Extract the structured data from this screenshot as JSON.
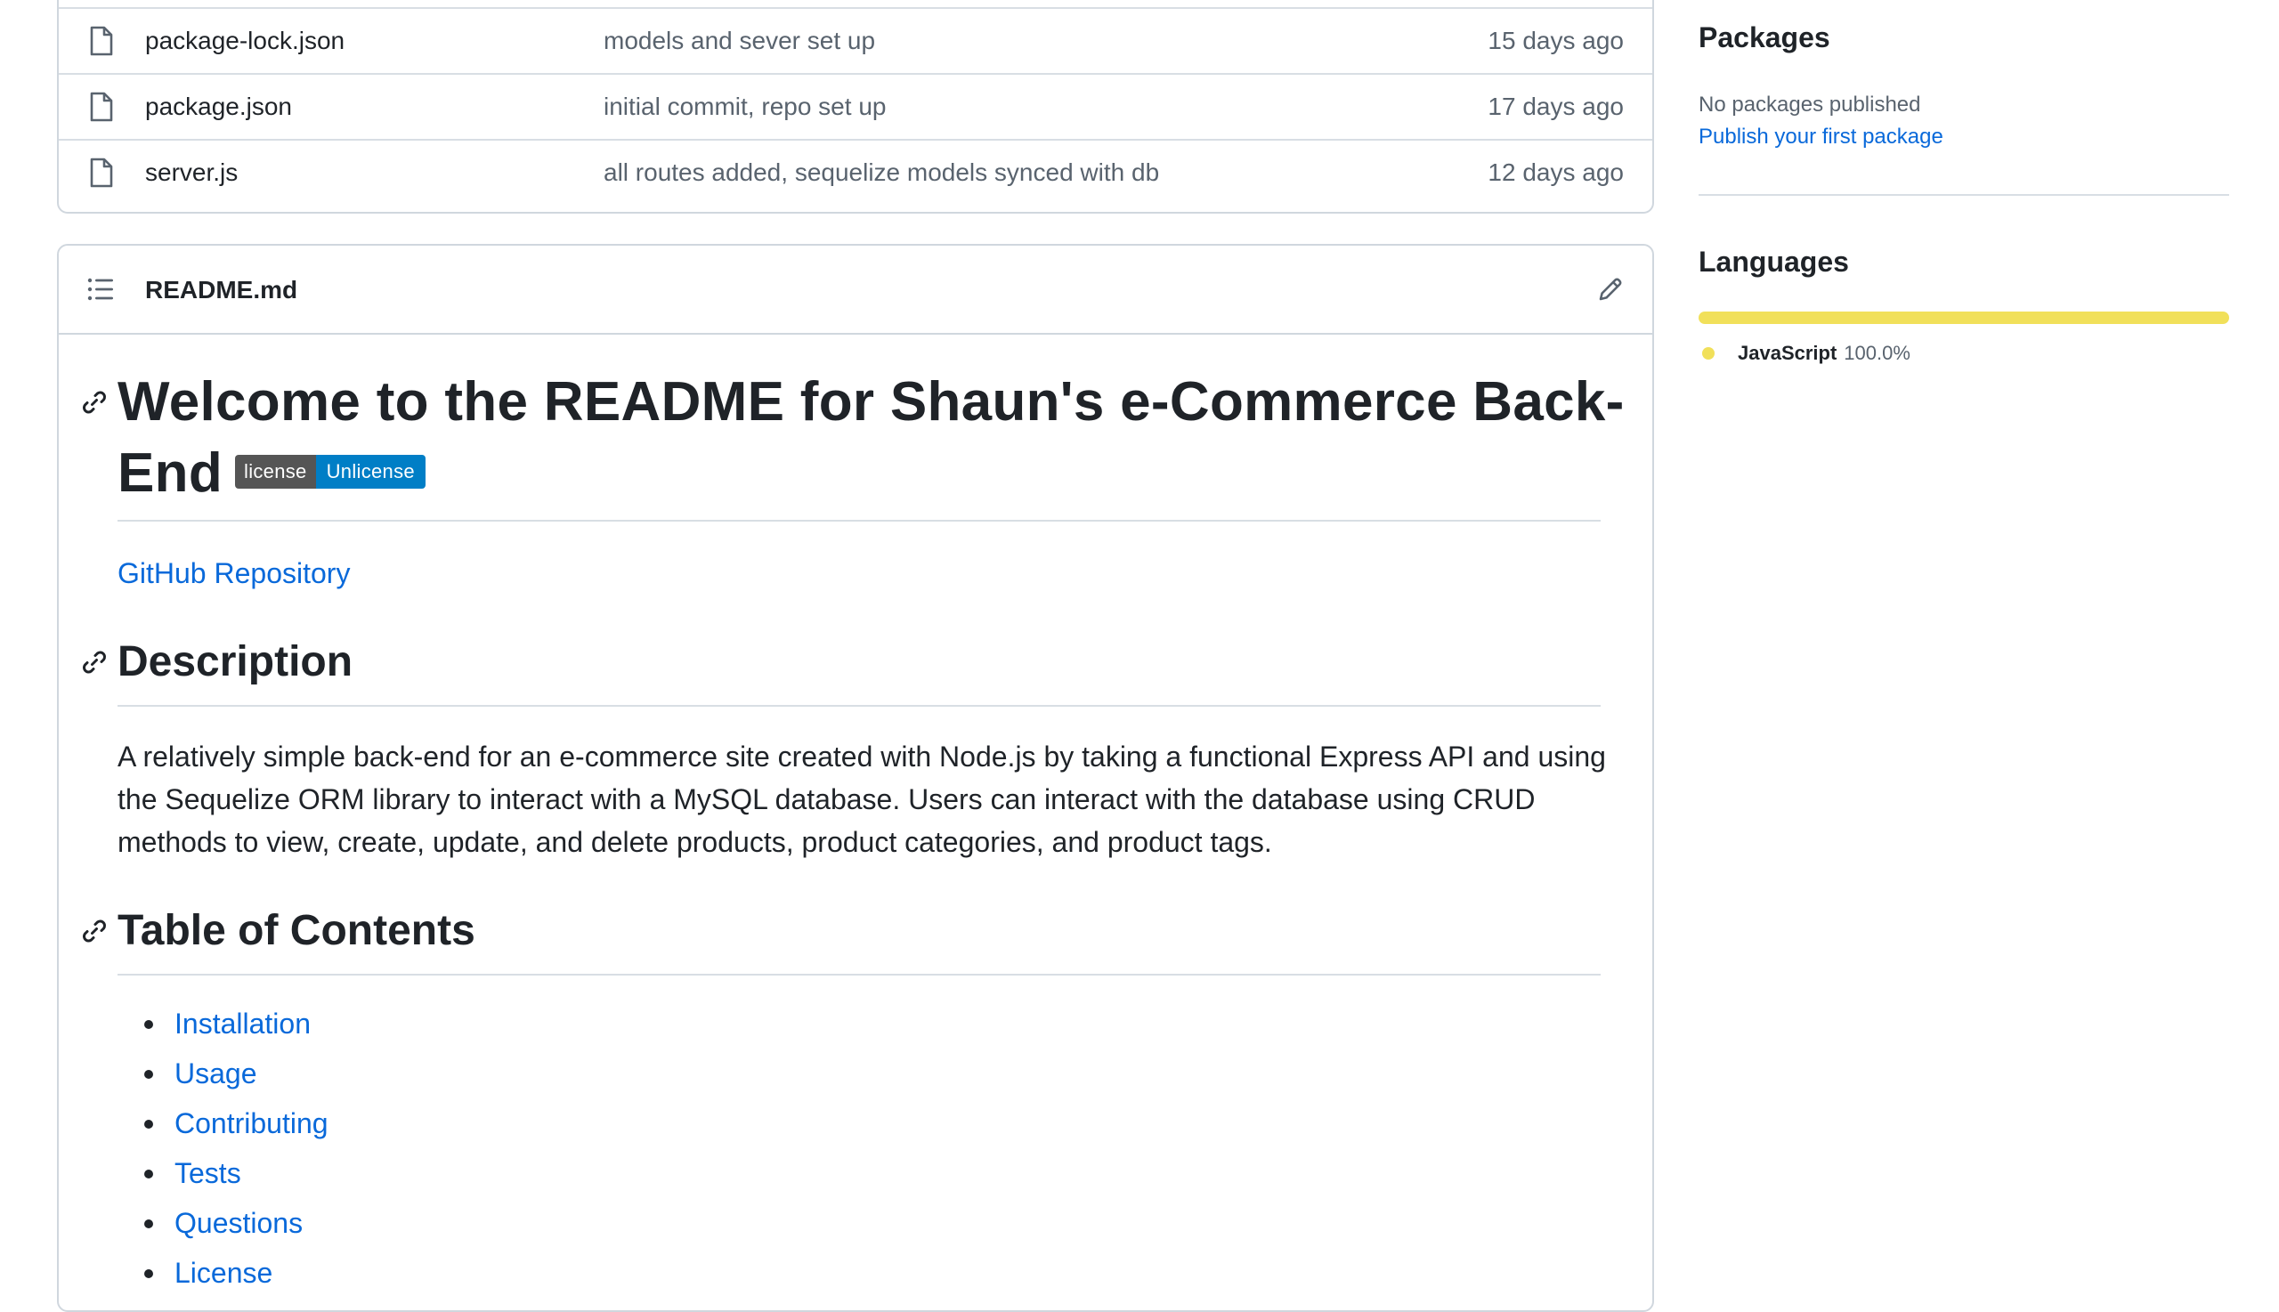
{
  "files": [
    {
      "name": "package-lock.json",
      "message": "models and sever set up",
      "date": "15 days ago"
    },
    {
      "name": "package.json",
      "message": "initial commit, repo set up",
      "date": "17 days ago"
    },
    {
      "name": "server.js",
      "message": "all routes added, sequelize models synced with db",
      "date": "12 days ago"
    }
  ],
  "readme": {
    "filename": "README.md",
    "title": "Welcome to the README for Shaun's e-Commerce Back-End",
    "badge": {
      "left": "license",
      "right": "Unlicense"
    },
    "repo_link": "GitHub Repository",
    "description_heading": "Description",
    "description_text": "A relatively simple back-end for an e-commerce site created with Node.js by taking a functional Express API and using the Sequelize ORM library to interact with a MySQL database. Users can interact with the database using CRUD methods to view, create, update, and delete products, product categories, and product tags.",
    "toc_heading": "Table of Contents",
    "toc": [
      "Installation",
      "Usage",
      "Contributing",
      "Tests",
      "Questions",
      "License"
    ]
  },
  "sidebar": {
    "packages_heading": "Packages",
    "packages_none": "No packages published",
    "packages_link": "Publish your first package",
    "languages_heading": "Languages",
    "languages": [
      {
        "name": "JavaScript",
        "percent": "100.0%",
        "color": "#f1e05a"
      }
    ]
  },
  "icons": {
    "file": "file-icon",
    "list": "list-icon",
    "edit": "pencil-icon",
    "anchor": "link-icon"
  }
}
